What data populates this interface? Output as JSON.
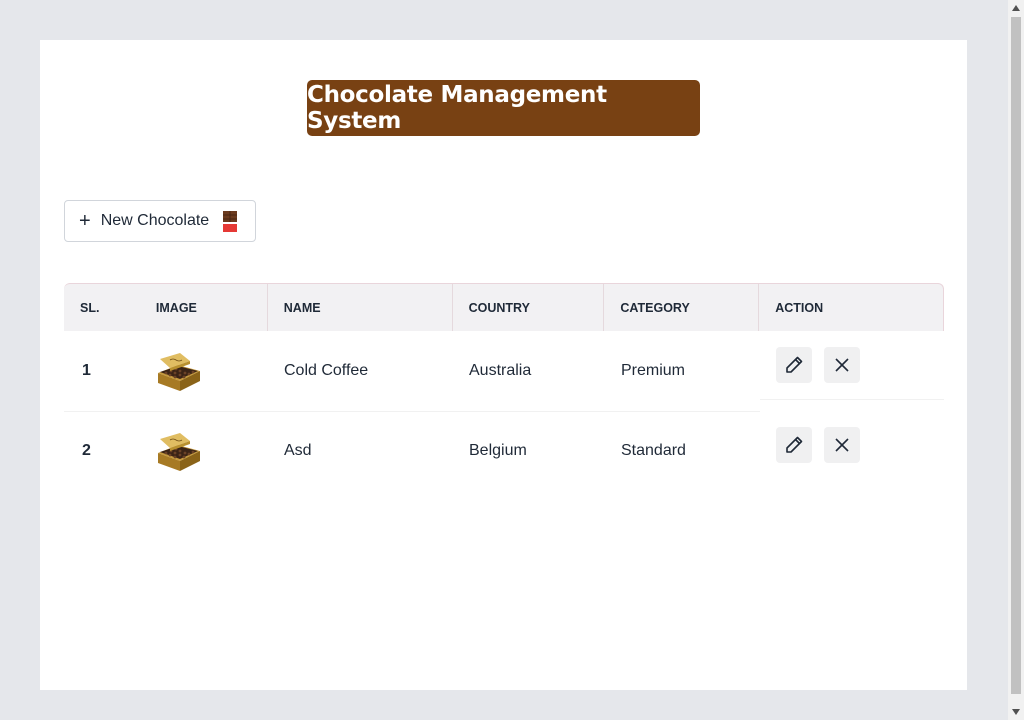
{
  "header": {
    "title": "Chocolate Management System"
  },
  "toolbar": {
    "plus_glyph": "+",
    "new_label": "New Chocolate",
    "new_icon": "chocolate-bar-icon"
  },
  "table": {
    "columns": [
      "SL.",
      "IMAGE",
      "NAME",
      "COUNTRY",
      "CATEGORY",
      "ACTION"
    ],
    "rows": [
      {
        "sl": "1",
        "name": "Cold Coffee",
        "country": "Australia",
        "category": "Premium"
      },
      {
        "sl": "2",
        "name": "Asd",
        "country": "Belgium",
        "category": "Standard"
      }
    ]
  },
  "colors": {
    "accent": "#784113",
    "page_bg": "#e5e7eb",
    "header_bg": "#f2f1f3"
  }
}
